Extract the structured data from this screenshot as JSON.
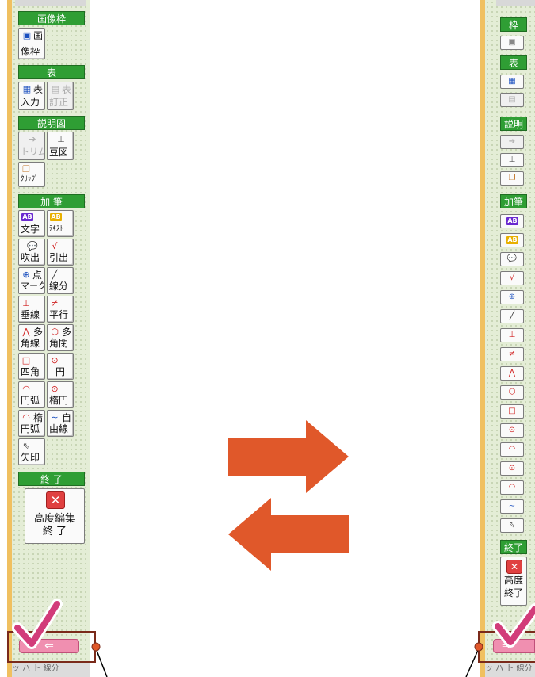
{
  "left_panel": {
    "sections": {
      "image_frame": "画像枠",
      "table": "表",
      "explanation": "説明図",
      "annotation": "加 筆",
      "end": "終 了"
    },
    "buttons": {
      "image_frame": [
        "画",
        "像枠"
      ],
      "table_input": [
        "表",
        "入力"
      ],
      "table_correct": [
        "表",
        "訂正"
      ],
      "trim": "トリム",
      "bean_figure": "豆図",
      "clip": "ｸﾘｯﾌﾟ",
      "text": "文字",
      "text_box": "ﾃｷｽﾄ",
      "speech_bubble": "吹出",
      "leader": "引出",
      "point_mark": [
        "点",
        "マーク"
      ],
      "line_segment": "線分",
      "perpendicular": "垂線",
      "parallel": "平行",
      "polyline": [
        "多",
        "角線"
      ],
      "polygon": [
        "多",
        "角閉"
      ],
      "rectangle": "四角",
      "circle": "円",
      "arc": "円弧",
      "ellipse": "楕円",
      "elliptical_arc": [
        "楕",
        "円弧"
      ],
      "freehand": [
        "自",
        "由線"
      ],
      "arrow": "矢印"
    },
    "end_button": [
      "高度編集",
      "終 了"
    ],
    "bottom_strip": "ッ ハ ト 線分"
  },
  "right_panel": {
    "sections": {
      "frame": "枠",
      "table": "表",
      "explanation": "説明",
      "annotation": "加筆",
      "end": "終了"
    },
    "end_button": [
      "高度",
      "終了"
    ]
  },
  "colors": {
    "panel_bg": "#e4edd6",
    "header_green": "#2f9e34",
    "arrow_orange": "#e0582a",
    "check_pink": "#d23c7a",
    "callout_dark": "#7a2a1a",
    "toggle_pink": "#f08fb0"
  },
  "icons": [
    "image-icon",
    "table-icon",
    "trim-icon",
    "figure-icon",
    "clip-icon",
    "text-icon",
    "bubble-icon",
    "leader-icon",
    "point-icon",
    "line-icon",
    "perpendicular-icon",
    "parallel-icon",
    "polyline-icon",
    "polygon-icon",
    "rectangle-icon",
    "circle-icon",
    "arc-icon",
    "ellipse-icon",
    "elliptical-arc-icon",
    "freehand-icon",
    "arrow-cursor-icon",
    "close-icon",
    "checkmark-icon",
    "arrow-right-icon",
    "arrow-left-icon"
  ]
}
